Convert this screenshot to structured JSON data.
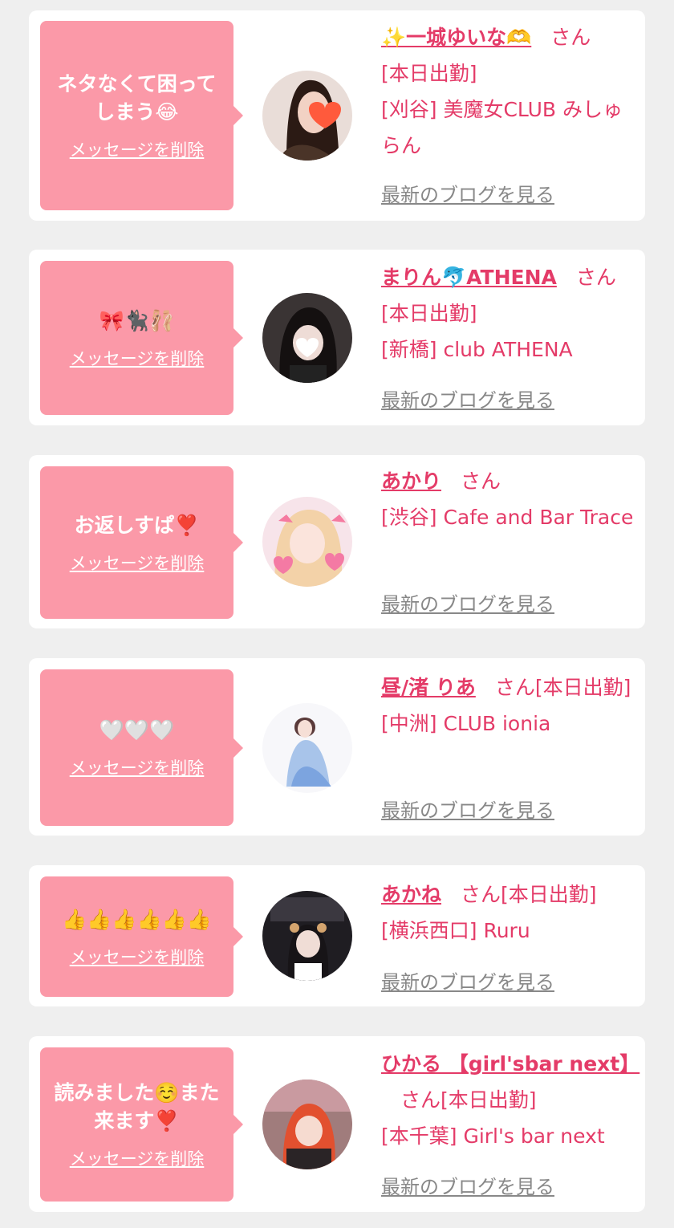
{
  "common": {
    "delete_label": "メッセージを削除",
    "blog_label": "最新のブログを見る",
    "san_label": "さん",
    "on_duty_label": "[本日出勤]"
  },
  "colors": {
    "bubble": "#fb99a8",
    "accent": "#e43b68",
    "link_gray": "#888888",
    "background": "#efefef"
  },
  "messages": [
    {
      "bubble_text": "ネタなくて困って\nしまう😂",
      "cast_name": "✨一城ゆいな🫶",
      "on_duty": "[本日出勤]",
      "shop": "[刈谷] 美魔女CLUB みしゅらん",
      "avatar_icon": "cast-photo-icon"
    },
    {
      "bubble_text": "🎀🐈‍⬛🩰",
      "cast_name": "まりん🐬ATHENA",
      "on_duty": "[本日出勤]",
      "shop": "[新橋] club ATHENA",
      "avatar_icon": "cast-photo-icon"
    },
    {
      "bubble_text": "お返しすぱ❣️",
      "cast_name": "あかり",
      "on_duty": "",
      "shop": "[渋谷] Cafe and Bar Trace",
      "avatar_icon": "cast-photo-icon"
    },
    {
      "bubble_text": "🤍🤍🤍",
      "cast_name": "昼/渚 りあ",
      "on_duty": "[本日出勤]",
      "shop": "[中洲] CLUB ionia",
      "avatar_icon": "cast-photo-icon"
    },
    {
      "bubble_text": "👍👍👍👍👍👍",
      "cast_name": "あかね",
      "on_duty": "[本日出勤]",
      "shop": "[横浜西口] Ruru",
      "avatar_icon": "cast-photo-icon"
    },
    {
      "bubble_text": "読みました☺️また\n来ます❣️",
      "cast_name": "ひかる 【girl'sbar next】",
      "on_duty": "[本日出勤]",
      "shop": "[本千葉] Girl's bar next",
      "avatar_icon": "cast-photo-icon"
    }
  ]
}
